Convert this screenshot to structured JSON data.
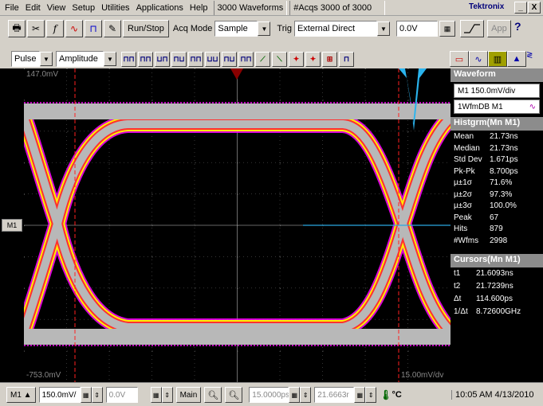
{
  "menu": {
    "items": [
      "File",
      "Edit",
      "View",
      "Setup",
      "Utilities",
      "Applications",
      "Help"
    ],
    "waveform_count": "3000 Waveforms",
    "acqs": "#Acqs  3000 of 3000",
    "brand": "Tektronix",
    "min": "_",
    "close": "X"
  },
  "toolbar": {
    "runstop": "Run/Stop",
    "acqmode_label": "Acq Mode",
    "acqmode_value": "Sample",
    "trig_label": "Trig",
    "trig_value": "External Direct",
    "level_value": "0.0V",
    "app_label": "App",
    "help": "?"
  },
  "measbar": {
    "measure_type": "Pulse",
    "measure_param": "Amplitude"
  },
  "screen": {
    "top_label": "147.0mV",
    "bottom_label": "-753.0mV",
    "bottom_right_label": "15.00mV/dv",
    "ch_marker": "M1"
  },
  "side": {
    "waveform_title": "Waveform",
    "scale": "M1 150.0mV/div",
    "wfmdb": "1WfmDB M1",
    "histogram_title": "Histgrm(Mn M1)",
    "histogram": [
      {
        "k": "Mean",
        "v": "21.73ns"
      },
      {
        "k": "Median",
        "v": "21.73ns"
      },
      {
        "k": "Std Dev",
        "v": "1.671ps"
      },
      {
        "k": "Pk-Pk",
        "v": "8.700ps"
      },
      {
        "k": "µ±1σ",
        "v": "71.6%"
      },
      {
        "k": "µ±2σ",
        "v": "97.3%"
      },
      {
        "k": "µ±3σ",
        "v": "100.0%"
      },
      {
        "k": "Peak",
        "v": "67"
      },
      {
        "k": "Hits",
        "v": "879"
      },
      {
        "k": "#Wfms",
        "v": "2998"
      }
    ],
    "cursors_title": "Cursors(Mn M1)",
    "cursors": [
      {
        "k": "t1",
        "v": "21.6093ns"
      },
      {
        "k": "t2",
        "v": "21.7239ns"
      },
      {
        "k": "Δt",
        "v": "114.600ps"
      },
      {
        "k": "1/Δt",
        "v": "8.72600GHz"
      }
    ]
  },
  "status": {
    "channel": "M1",
    "scale": "150.0mV/",
    "offset": "0.0V",
    "main": "Main",
    "time": "15.0000ps",
    "position": "21.6663r",
    "temp": "°C",
    "clock": "10:05 AM 4/13/2010"
  }
}
